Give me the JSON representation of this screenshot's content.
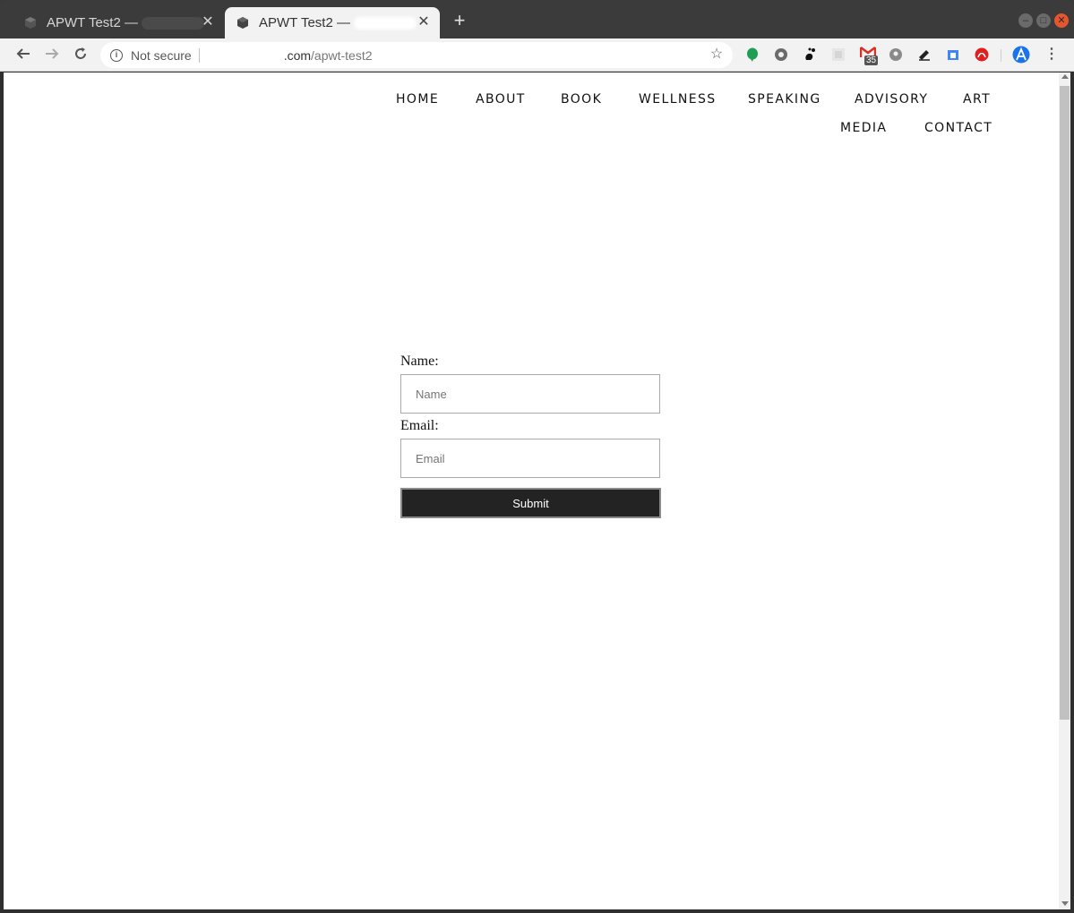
{
  "browser": {
    "tabs": [
      {
        "title": "APWT Test2 —",
        "active": false
      },
      {
        "title": "APWT Test2 —",
        "active": true
      }
    ],
    "new_tab": "+",
    "close_glyph": "✕",
    "omnibox": {
      "security_label": "Not secure",
      "url_domain": ".com",
      "url_path": "/apwt-test2"
    },
    "extensions": [
      "evernote-icon",
      "gear-ext-icon",
      "gnome-ext-icon",
      "ext-placeholder-icon",
      "gmail-icon",
      "location-ext-icon",
      "pen-ext-icon",
      "calendar-ext-icon",
      "adobe-ext-icon",
      "profile-avatar-icon"
    ],
    "gmail_badge": "35"
  },
  "site": {
    "nav": {
      "items": [
        "HOME",
        "ABOUT",
        "BOOK",
        "WELLNESS",
        "SPEAKING",
        "ADVISORY",
        "ART",
        "MEDIA",
        "CONTACT"
      ]
    },
    "form": {
      "name_label": "Name:",
      "name_placeholder": "Name",
      "email_label": "Email:",
      "email_placeholder": "Email",
      "submit_label": "Submit"
    }
  },
  "colors": {
    "submit_bg": "#232323",
    "tab_active_bg": "#f2f2f2",
    "frame_bg": "#3b3b3b",
    "close_window": "#e4572e",
    "evernote_green": "#1f9d55",
    "gmail_red": "#d93025"
  }
}
